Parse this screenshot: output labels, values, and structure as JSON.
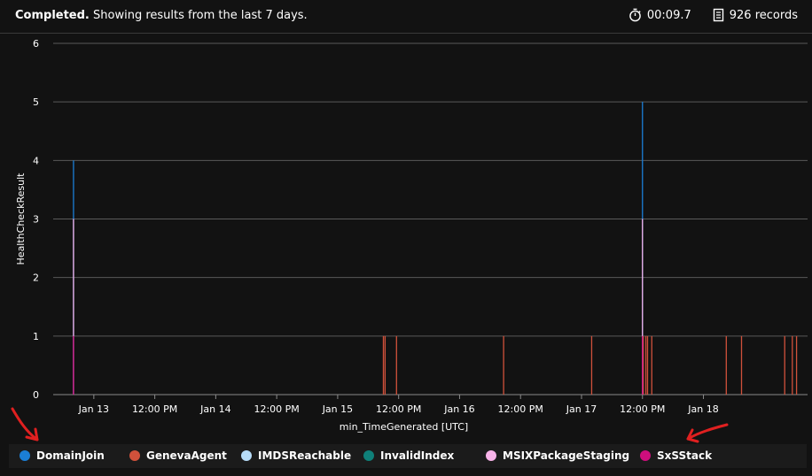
{
  "status": {
    "completed": "Completed.",
    "message": "Showing results from the last 7 days.",
    "duration": "00:09.7",
    "records": "926 records"
  },
  "icons": {
    "timer": "stopwatch-icon",
    "records": "records-icon"
  },
  "chart_data": {
    "type": "bar",
    "ylabel": "HealthCheckResult",
    "xlabel": "min_TimeGenerated [UTC]",
    "ylim": [
      0,
      6
    ],
    "yticks": [
      "0",
      "1",
      "2",
      "3",
      "4",
      "5",
      "6"
    ],
    "grid": true,
    "legend": "bottom",
    "xlim": [
      "2024-01-12 16:00",
      "2024-01-18 20:30"
    ],
    "xticks": [
      {
        "t": "2024-01-13 00:00",
        "label": "Jan 13"
      },
      {
        "t": "2024-01-13 12:00",
        "label": "12:00 PM"
      },
      {
        "t": "2024-01-14 00:00",
        "label": "Jan 14"
      },
      {
        "t": "2024-01-14 12:00",
        "label": "12:00 PM"
      },
      {
        "t": "2024-01-15 00:00",
        "label": "Jan 15"
      },
      {
        "t": "2024-01-15 12:00",
        "label": "12:00 PM"
      },
      {
        "t": "2024-01-16 00:00",
        "label": "Jan 16"
      },
      {
        "t": "2024-01-16 12:00",
        "label": "12:00 PM"
      },
      {
        "t": "2024-01-17 00:00",
        "label": "Jan 17"
      },
      {
        "t": "2024-01-17 12:00",
        "label": "12:00 PM"
      },
      {
        "t": "2024-01-18 00:00",
        "label": "Jan 18"
      }
    ],
    "series": [
      {
        "name": "DomainJoin",
        "color": "#1b7ed6",
        "points": [
          {
            "t": "2024-01-12 20:00",
            "y": 4
          },
          {
            "t": "2024-01-17 12:00",
            "y": 5
          }
        ]
      },
      {
        "name": "GenevaAgent",
        "color": "#d0513b",
        "points": [
          {
            "t": "2024-01-15 09:00",
            "y": 1
          },
          {
            "t": "2024-01-15 09:20",
            "y": 1
          },
          {
            "t": "2024-01-15 11:35",
            "y": 1
          },
          {
            "t": "2024-01-16 08:40",
            "y": 1
          },
          {
            "t": "2024-01-17 02:00",
            "y": 1
          },
          {
            "t": "2024-01-17 12:10",
            "y": 1
          },
          {
            "t": "2024-01-17 12:40",
            "y": 1
          },
          {
            "t": "2024-01-17 13:00",
            "y": 1
          },
          {
            "t": "2024-01-17 13:50",
            "y": 1
          },
          {
            "t": "2024-01-18 04:30",
            "y": 1
          },
          {
            "t": "2024-01-18 07:30",
            "y": 1
          },
          {
            "t": "2024-01-18 16:00",
            "y": 1
          },
          {
            "t": "2024-01-18 17:30",
            "y": 1
          },
          {
            "t": "2024-01-18 18:20",
            "y": 1
          }
        ]
      },
      {
        "name": "IMDSReachable",
        "color": "#b7dcf8",
        "points": []
      },
      {
        "name": "InvalidIndex",
        "color": "#0f8079",
        "points": []
      },
      {
        "name": "MSIXPackageStaging",
        "color": "#f7b3e9",
        "points": [
          {
            "t": "2024-01-12 20:00",
            "y": 3
          },
          {
            "t": "2024-01-17 12:00",
            "y": 3
          }
        ]
      },
      {
        "name": "SxSStack",
        "color": "#cf0e7d",
        "points": [
          {
            "t": "2024-01-12 20:00",
            "y": 1
          },
          {
            "t": "2024-01-17 12:00",
            "y": 1
          }
        ]
      }
    ]
  }
}
